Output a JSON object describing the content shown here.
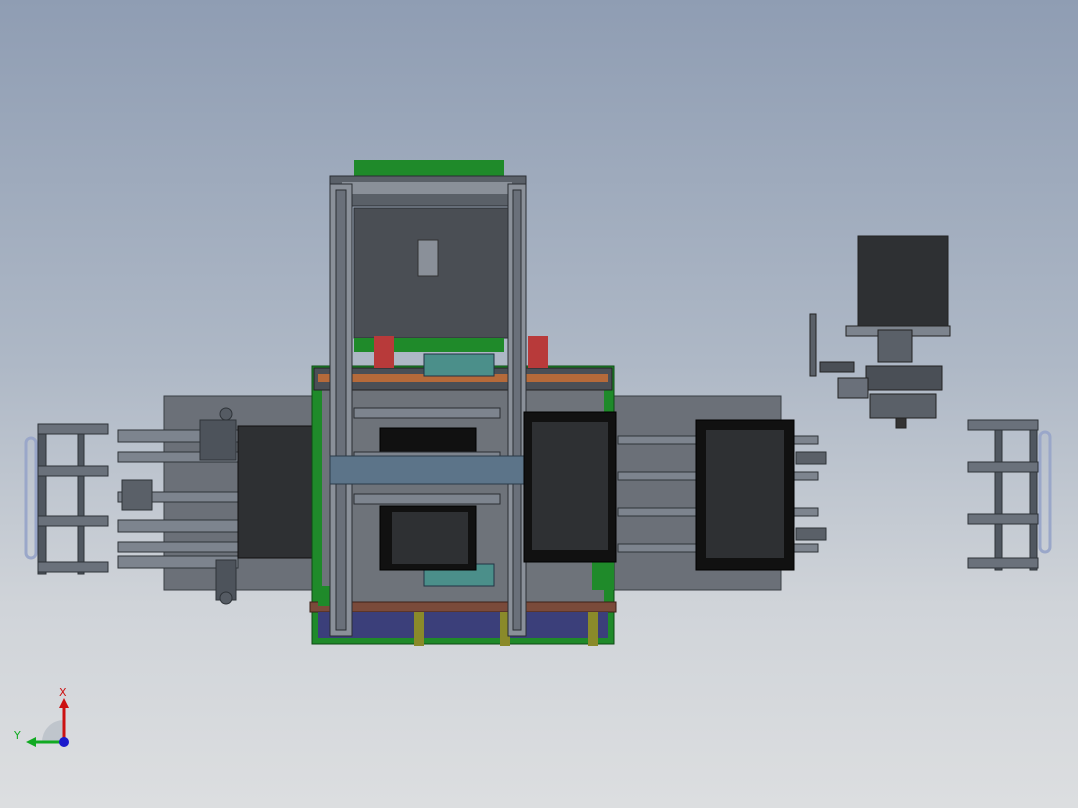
{
  "viewport": {
    "background_top": "#8f9db3",
    "background_bottom": "#dcdee0"
  },
  "colors": {
    "frame_green": "#1f8a2a",
    "frame_dark": "#3a3f45",
    "panel_gray": "#6b7078",
    "screen_black": "#111111",
    "screen_dark": "#2e3033",
    "rail_gray": "#8a9099",
    "base_purple": "#3b3f7a",
    "base_brown": "#7a4a3a",
    "teal_block": "#4b8f8a",
    "red_cylinder": "#b83a3a",
    "slate_beam": "#5c7489",
    "x_axis": "#cc1111",
    "y_axis": "#11aa22",
    "z_axis": "#1a1acc"
  },
  "triad": {
    "x_label": "X",
    "y_label": "Y",
    "icon": "coordinate-triad-icon"
  }
}
